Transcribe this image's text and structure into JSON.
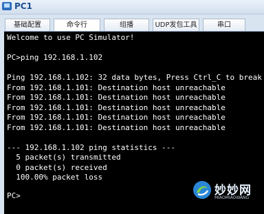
{
  "window": {
    "title": "PC1"
  },
  "tabs": [
    {
      "label": "基础配置"
    },
    {
      "label": "命令行"
    },
    {
      "label": "组播"
    },
    {
      "label": "UDP发包工具"
    },
    {
      "label": "串口"
    }
  ],
  "active_tab": "命令行",
  "terminal": {
    "lines": [
      "Welcome to use PC Simulator!",
      "",
      "PC>ping 192.168.1.102",
      "",
      "Ping 192.168.1.102: 32 data bytes, Press Ctrl_C to break",
      "From 192.168.1.101: Destination host unreachable",
      "From 192.168.1.101: Destination host unreachable",
      "From 192.168.1.101: Destination host unreachable",
      "From 192.168.1.101: Destination host unreachable",
      "From 192.168.1.101: Destination host unreachable",
      "",
      "--- 192.168.1.102 ping statistics ---",
      "  5 packet(s) transmitted",
      "  0 packet(s) received",
      "  100.00% packet loss",
      "",
      "",
      "PC>"
    ]
  },
  "watermark": {
    "text": "妙妙网",
    "subtext": "MIAOMIAOWANG"
  }
}
